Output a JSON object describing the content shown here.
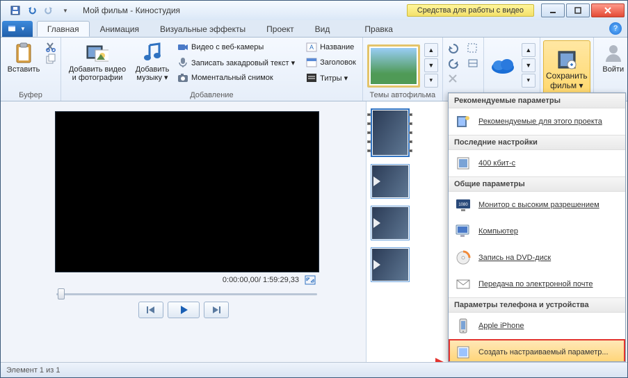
{
  "titlebar": {
    "title": "Мой фильм - Киностудия",
    "contextual": "Средства для работы с видео"
  },
  "tabs": {
    "file": "",
    "main": "Главная",
    "animation": "Анимация",
    "visual": "Визуальные эффекты",
    "project": "Проект",
    "view": "Вид",
    "edit": "Правка"
  },
  "ribbon": {
    "paste": "Вставить",
    "buffer_group": "Буфер",
    "add_video": "Добавить видео и фотографии",
    "add_music": "Добавить музыку ▾",
    "webcam": "Видео с веб-камеры",
    "voiceover": "Записать закадровый текст ▾",
    "snapshot": "Моментальный снимок",
    "name": "Название",
    "header": "Заголовок",
    "titles": "Титры ▾",
    "add_group": "Добавление",
    "themes_group": "Темы автофильма",
    "save": "Сохранить фильм ▾",
    "signin": "Войти"
  },
  "preview": {
    "time": "0:00:00,00/ 1:59:29,33"
  },
  "dropdown": {
    "s1": "Рекомендуемые параметры",
    "i1": "Рекомендуемые для этого проекта",
    "s2": "Последние настройки",
    "i2": "400 кбит-с",
    "s3": "Общие параметры",
    "i3": "Монитор с высоким разрешением",
    "i4": "Компьютер",
    "i5": "Запись на DVD-диск",
    "i6": "Передача по электронной почте",
    "s4": "Параметры телефона и устройства",
    "i7": "Apple iPhone",
    "i8": "Создать настраиваемый параметр..."
  },
  "status": {
    "element": "Элемент 1 из 1"
  }
}
